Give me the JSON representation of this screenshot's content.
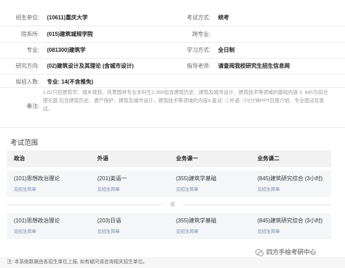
{
  "info": {
    "school_label": "招生单位:",
    "school_value": "(10611)重庆大学",
    "exam_type_label": "考试方式:",
    "exam_type_value": "统考",
    "department_label": "院系所:",
    "department_value": "(015)建筑城规学院",
    "cross_label": "跨专业:",
    "cross_value": "",
    "major_label": "专业:",
    "major_value": "(081300)建筑学",
    "study_mode_label": "学习方式:",
    "study_mode_value": "全日制",
    "direction_label": "研究方向:",
    "direction_value": "(02)建筑设计及其理论 (含城市设计)",
    "advisor_label": "指导老师:",
    "advisor_value": "请查阅我校研究生招生信息网",
    "enroll_label": "拟招人数:",
    "enroll_value": "专业: 14(不含推免)",
    "remark_label": "备注:",
    "remark_value": "1.02只招建筑学、城乡规划、风景园林专业本科生2.355包含建筑历史、建筑及城市设计、建筑技术等领域的基础内容 3. 845为综合理论题,包含建筑历史、遗产保护、建筑及城市设计、建筑技术等领域的内容4.复试: ①外语; ②5分钟PPT自我介绍、专业面试及笔试。"
  },
  "exam_scope": {
    "title": "考试范围",
    "headers": [
      "政治",
      "外语",
      "业务课一",
      "业务课二"
    ],
    "option_a": [
      {
        "name": "(101)思想政治理论",
        "link": "见招生简章"
      },
      {
        "name": "(201)英语一",
        "link": "见招生简章"
      },
      {
        "name": "(355)建筑学基础",
        "link": "见招生简章"
      },
      {
        "name": "(845)建筑研究综合 (3小时)",
        "link": "见招生简章"
      }
    ],
    "or_label": "或",
    "option_b": [
      {
        "name": "(101)思想政治理论",
        "link": "见招生简章"
      },
      {
        "name": "(203)日语",
        "link": "见招生简章"
      },
      {
        "name": "(355)建筑学基础",
        "link": "见招生简章"
      },
      {
        "name": "(845)建筑研究综合 (3小时)",
        "link": "见招生简章"
      }
    ]
  },
  "footer": {
    "note": "注: 本系统数据由各招生单位上报, 如有疑问请咨询相关招生单位。",
    "brand": "四方手绘考研中心"
  }
}
